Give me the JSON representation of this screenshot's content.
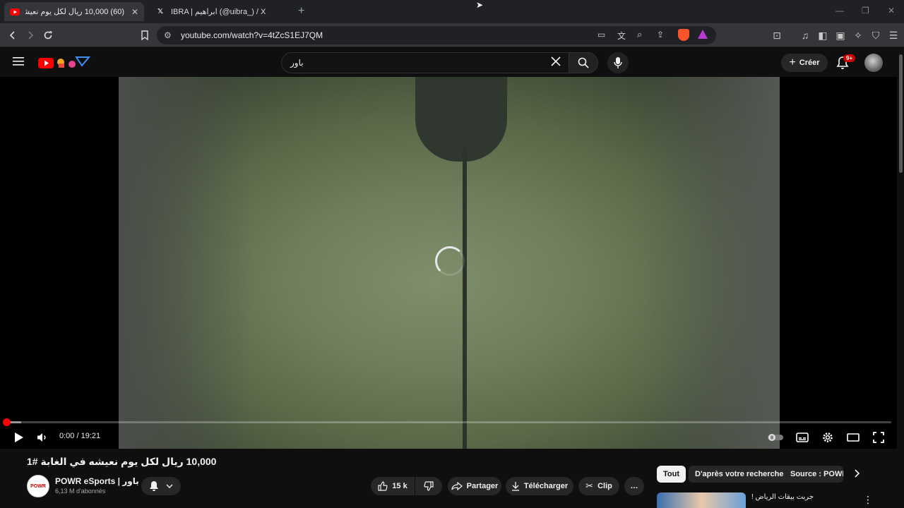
{
  "browser": {
    "tabs": [
      {
        "title": "(60) 10,000 ريال لكل يوم نعيشه ف",
        "active": true,
        "icon": "youtube-icon"
      },
      {
        "title": "IBRA | ابراهيم (@uibra_) / X",
        "active": false,
        "icon": "x-logo-icon"
      }
    ],
    "new_tab": "+",
    "url": "youtube.com/watch?v=4tZcS1EJ7QM"
  },
  "youtube": {
    "search_query": "باور",
    "create_label": "Créer",
    "notifications_badge": "9+",
    "player": {
      "time": "0:00 / 19:21",
      "progress_fraction": 0.0
    },
    "video": {
      "title": "10,000 ريال لكل يوم نعيشه في الغابة #1",
      "channel": "POWR eSports | باور",
      "subscribers": "6,13 M d'abonnés",
      "avatar_text": "POWR",
      "likes": "15 k",
      "share_label": "Partager",
      "download_label": "Télécharger",
      "clip_label": "Clip",
      "more": "…"
    },
    "chips": [
      "Tout",
      "D'après votre recherche",
      "Source : POWR"
    ],
    "recommendation": {
      "title": "جربت بيقات الرياض !"
    }
  },
  "colors": {
    "accent_red": "#ff0000",
    "background": "#0f0f0f",
    "surface": "#272727"
  }
}
